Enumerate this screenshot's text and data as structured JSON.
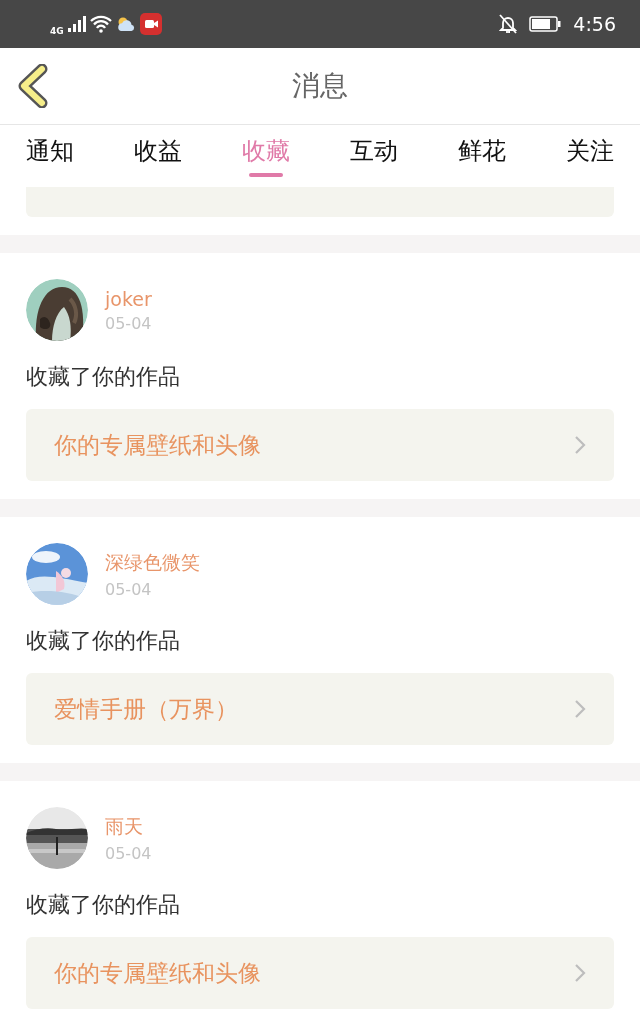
{
  "status_bar": {
    "network": "4G",
    "time": "4:56"
  },
  "header": {
    "title": "消息"
  },
  "tabs": [
    {
      "label": "通知",
      "selected": false
    },
    {
      "label": "收益",
      "selected": false
    },
    {
      "label": "收藏",
      "selected": true
    },
    {
      "label": "互动",
      "selected": false
    },
    {
      "label": "鲜花",
      "selected": false
    },
    {
      "label": "关注",
      "selected": false
    }
  ],
  "messages": [
    {
      "name": "joker",
      "date": "05-04",
      "action": "收藏了你的作品",
      "work": "你的专属壁纸和头像"
    },
    {
      "name": "深绿色微笑",
      "date": "05-04",
      "action": "收藏了你的作品",
      "work": "爱情手册（万界）"
    },
    {
      "name": "雨天",
      "date": "05-04",
      "action": "收藏了你的作品",
      "work": "你的专属壁纸和头像"
    }
  ]
}
